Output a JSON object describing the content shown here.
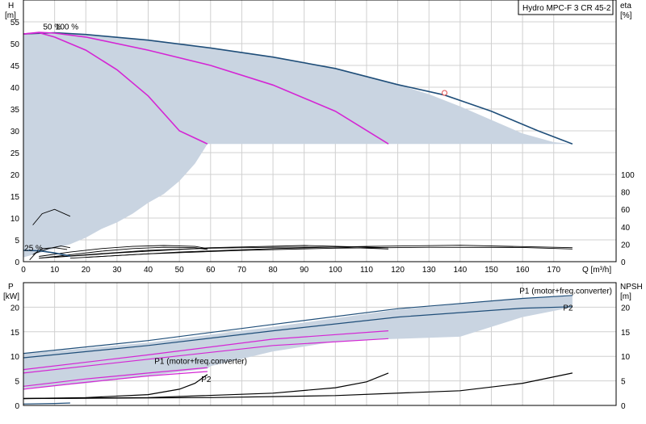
{
  "title": "Hydro MPC-F 3 CR 45-2",
  "chart_data": [
    {
      "type": "line",
      "name": "H-Q",
      "xlabel": "Q [m³/h]",
      "ylabel_line1": "H",
      "ylabel_line2": "[m]",
      "y2label_line1": "eta",
      "y2label_line2": "[%]",
      "xlim": [
        0,
        190
      ],
      "ylim": [
        0,
        60
      ],
      "y2lim": [
        0,
        100
      ],
      "xticks": [
        0,
        10,
        20,
        30,
        40,
        50,
        60,
        70,
        80,
        90,
        100,
        110,
        120,
        130,
        140,
        150,
        160,
        170
      ],
      "yticks": [
        0,
        5,
        10,
        15,
        20,
        25,
        30,
        35,
        40,
        45,
        50,
        55
      ],
      "y2ticks": [
        0,
        20,
        40,
        60,
        80,
        100
      ],
      "grid": true,
      "colors": {
        "area": "#c9d4e1",
        "curve": "#1f4e79",
        "magenta": "#d426d4",
        "eta": "#000000",
        "marker": "#e05050"
      },
      "area_polygon": {
        "x": [
          0,
          5,
          10,
          15,
          20,
          30,
          40,
          50,
          60,
          70,
          80,
          90,
          100,
          110,
          120,
          130,
          140,
          150,
          160,
          170,
          176,
          176,
          160,
          140,
          120,
          100,
          80,
          60,
          59,
          55,
          50,
          45,
          40,
          35,
          30,
          25,
          20,
          15,
          10,
          5,
          0
        ],
        "y": [
          52.2,
          52.5,
          52.5,
          52.4,
          52.1,
          51.5,
          50.8,
          49.9,
          49.0,
          48.0,
          46.9,
          45.7,
          44.3,
          42.6,
          40.6,
          38.4,
          35.6,
          32.5,
          29.4,
          27.4,
          27.0,
          27.0,
          27.0,
          27.0,
          27.0,
          27.0,
          27.0,
          27.0,
          27.0,
          22.5,
          18.5,
          15.5,
          13.5,
          11.0,
          9.0,
          7.5,
          5.5,
          4.0,
          3.0,
          2.0,
          1.0
        ]
      },
      "curves": [
        {
          "name": "",
          "role": "max",
          "x": [
            0,
            10,
            20,
            40,
            60,
            80,
            100,
            120,
            135,
            150,
            165,
            176
          ],
          "y": [
            52.2,
            52.5,
            52.1,
            50.8,
            49.0,
            46.9,
            44.3,
            40.6,
            38.2,
            34.5,
            30.0,
            27.0
          ]
        },
        {
          "name": "",
          "role": "100%",
          "x": [
            0,
            5,
            10,
            20,
            40,
            60,
            80,
            100,
            117
          ],
          "y": [
            52.2,
            52.6,
            52.4,
            51.5,
            48.5,
            45.0,
            40.5,
            34.5,
            27.0
          ]
        },
        {
          "name": "",
          "role": "50%",
          "x": [
            0,
            5,
            10,
            20,
            30,
            40,
            50,
            59
          ],
          "y": [
            52.2,
            52.5,
            51.5,
            48.5,
            44.0,
            38.0,
            30.0,
            27.0
          ]
        },
        {
          "name": "",
          "role": "25%",
          "x": [
            0,
            5,
            10,
            15
          ],
          "y": [
            2.6,
            2.5,
            2.0,
            1.3
          ]
        }
      ],
      "eta_curves": [
        {
          "x": [
            3,
            6,
            10,
            14
          ],
          "y": [
            8,
            15,
            16,
            14
          ]
        },
        {
          "x": [
            3,
            6,
            10,
            15
          ],
          "y": [
            42,
            55,
            60,
            52
          ]
        },
        {
          "x": [
            2,
            4,
            8,
            12,
            15
          ],
          "y": [
            2,
            10,
            15,
            18,
            16
          ]
        },
        {
          "x": [
            5,
            15,
            25,
            35,
            45,
            55,
            59
          ],
          "y": [
            4,
            8,
            12,
            15,
            16.5,
            16,
            14
          ]
        },
        {
          "x": [
            5,
            15,
            25,
            35,
            45,
            55,
            59
          ],
          "y": [
            6,
            11,
            15,
            17.5,
            18.5,
            17.5,
            15
          ]
        },
        {
          "x": [
            5,
            20,
            40,
            60,
            80,
            100,
            117
          ],
          "y": [
            4,
            8,
            13,
            15.5,
            16.5,
            16.8,
            14.5
          ]
        },
        {
          "x": [
            10,
            30,
            60,
            90,
            117
          ],
          "y": [
            5,
            10,
            16,
            18.5,
            16
          ]
        },
        {
          "x": [
            15,
            40,
            70,
            100,
            130,
            160,
            176
          ],
          "y": [
            4,
            9,
            13,
            15.5,
            16.5,
            16.3,
            14.5
          ]
        },
        {
          "x": [
            20,
            50,
            80,
            110,
            140,
            176
          ],
          "y": [
            5,
            11,
            15,
            17.5,
            18.8,
            16
          ]
        }
      ],
      "marker": {
        "x": 135,
        "y": 38.7
      },
      "annotations": [
        {
          "text": "50 %",
          "x": 6.3,
          "y": 53.2
        },
        {
          "text": "100 %",
          "x": 10.3,
          "y": 53.2
        },
        {
          "text": "25 %",
          "x": 0.3,
          "y": 2.5
        }
      ]
    },
    {
      "type": "line",
      "name": "P-Q / NPSH-Q",
      "ylabel_line1": "P",
      "ylabel_line2": "[kW]",
      "y2label_line1": "NPSH",
      "y2label_line2": "[m]",
      "xlim": [
        0,
        190
      ],
      "ylim": [
        0,
        25
      ],
      "yticks": [
        0,
        5,
        10,
        15,
        20
      ],
      "y2ticks": [
        0,
        5,
        10,
        15,
        20
      ],
      "grid": true,
      "p_area": {
        "x": [
          0,
          40,
          80,
          120,
          160,
          176,
          176,
          160,
          140,
          117,
          100,
          80,
          60,
          59,
          40,
          20,
          0
        ],
        "y": [
          10.5,
          12.8,
          16.0,
          19.5,
          21.8,
          22.3,
          20.0,
          18.0,
          14.0,
          13.5,
          13.0,
          11.0,
          8.0,
          7.5,
          6.0,
          4.5,
          3.5
        ]
      },
      "p_curves": [
        {
          "name": "P1 (motor+freq.converter)",
          "color": "#1f4e79",
          "x": [
            0,
            40,
            80,
            120,
            160,
            176
          ],
          "y": [
            10.6,
            13.2,
            16.5,
            19.7,
            21.8,
            22.4
          ]
        },
        {
          "name": "P2",
          "color": "#1f4e79",
          "x": [
            0,
            40,
            80,
            120,
            160,
            176
          ],
          "y": [
            9.7,
            12.2,
            15.2,
            18.0,
            19.8,
            20.1
          ]
        },
        {
          "name": "",
          "color": "#d426d4",
          "x": [
            0,
            40,
            80,
            117
          ],
          "y": [
            7.3,
            10.3,
            13.5,
            15.2
          ]
        },
        {
          "name": "",
          "color": "#d426d4",
          "x": [
            0,
            40,
            80,
            117
          ],
          "y": [
            6.6,
            9.4,
            12.2,
            13.6
          ]
        },
        {
          "name": "P1 (motor+freq.converter)",
          "color": "#d426d4",
          "x": [
            0,
            20,
            40,
            59
          ],
          "y": [
            3.9,
            5.4,
            6.6,
            7.7
          ]
        },
        {
          "name": "P2",
          "color": "#d426d4",
          "x": [
            0,
            20,
            40,
            59
          ],
          "y": [
            3.3,
            4.7,
            6.0,
            6.9
          ]
        },
        {
          "name": "",
          "color": "#1f4e79",
          "x": [
            0,
            10,
            15
          ],
          "y": [
            0.3,
            0.4,
            0.5
          ]
        }
      ],
      "npsh_curves": [
        {
          "x": [
            0,
            20,
            40,
            50,
            55,
            59
          ],
          "y": [
            1.4,
            1.6,
            2.2,
            3.3,
            4.5,
            6.3
          ]
        },
        {
          "x": [
            0,
            40,
            80,
            100,
            110,
            117
          ],
          "y": [
            1.4,
            1.6,
            2.5,
            3.6,
            4.8,
            6.6
          ]
        },
        {
          "x": [
            0,
            60,
            100,
            140,
            160,
            176
          ],
          "y": [
            1.4,
            1.6,
            2.0,
            3.0,
            4.5,
            6.6
          ]
        }
      ],
      "labels": [
        {
          "text": "P1 (motor+freq.converter)",
          "color": "#1f4e79",
          "x": 159,
          "y": 22.8
        },
        {
          "text": "P2",
          "color": "#1f4e79",
          "x": 173,
          "y": 19.3
        },
        {
          "text": "P1 (motor+freq.converter)",
          "color": "#1f4e79",
          "x": 42,
          "y": 8.5
        },
        {
          "text": "P2",
          "color": "#1f4e79",
          "x": 57,
          "y": 4.8
        }
      ]
    }
  ]
}
